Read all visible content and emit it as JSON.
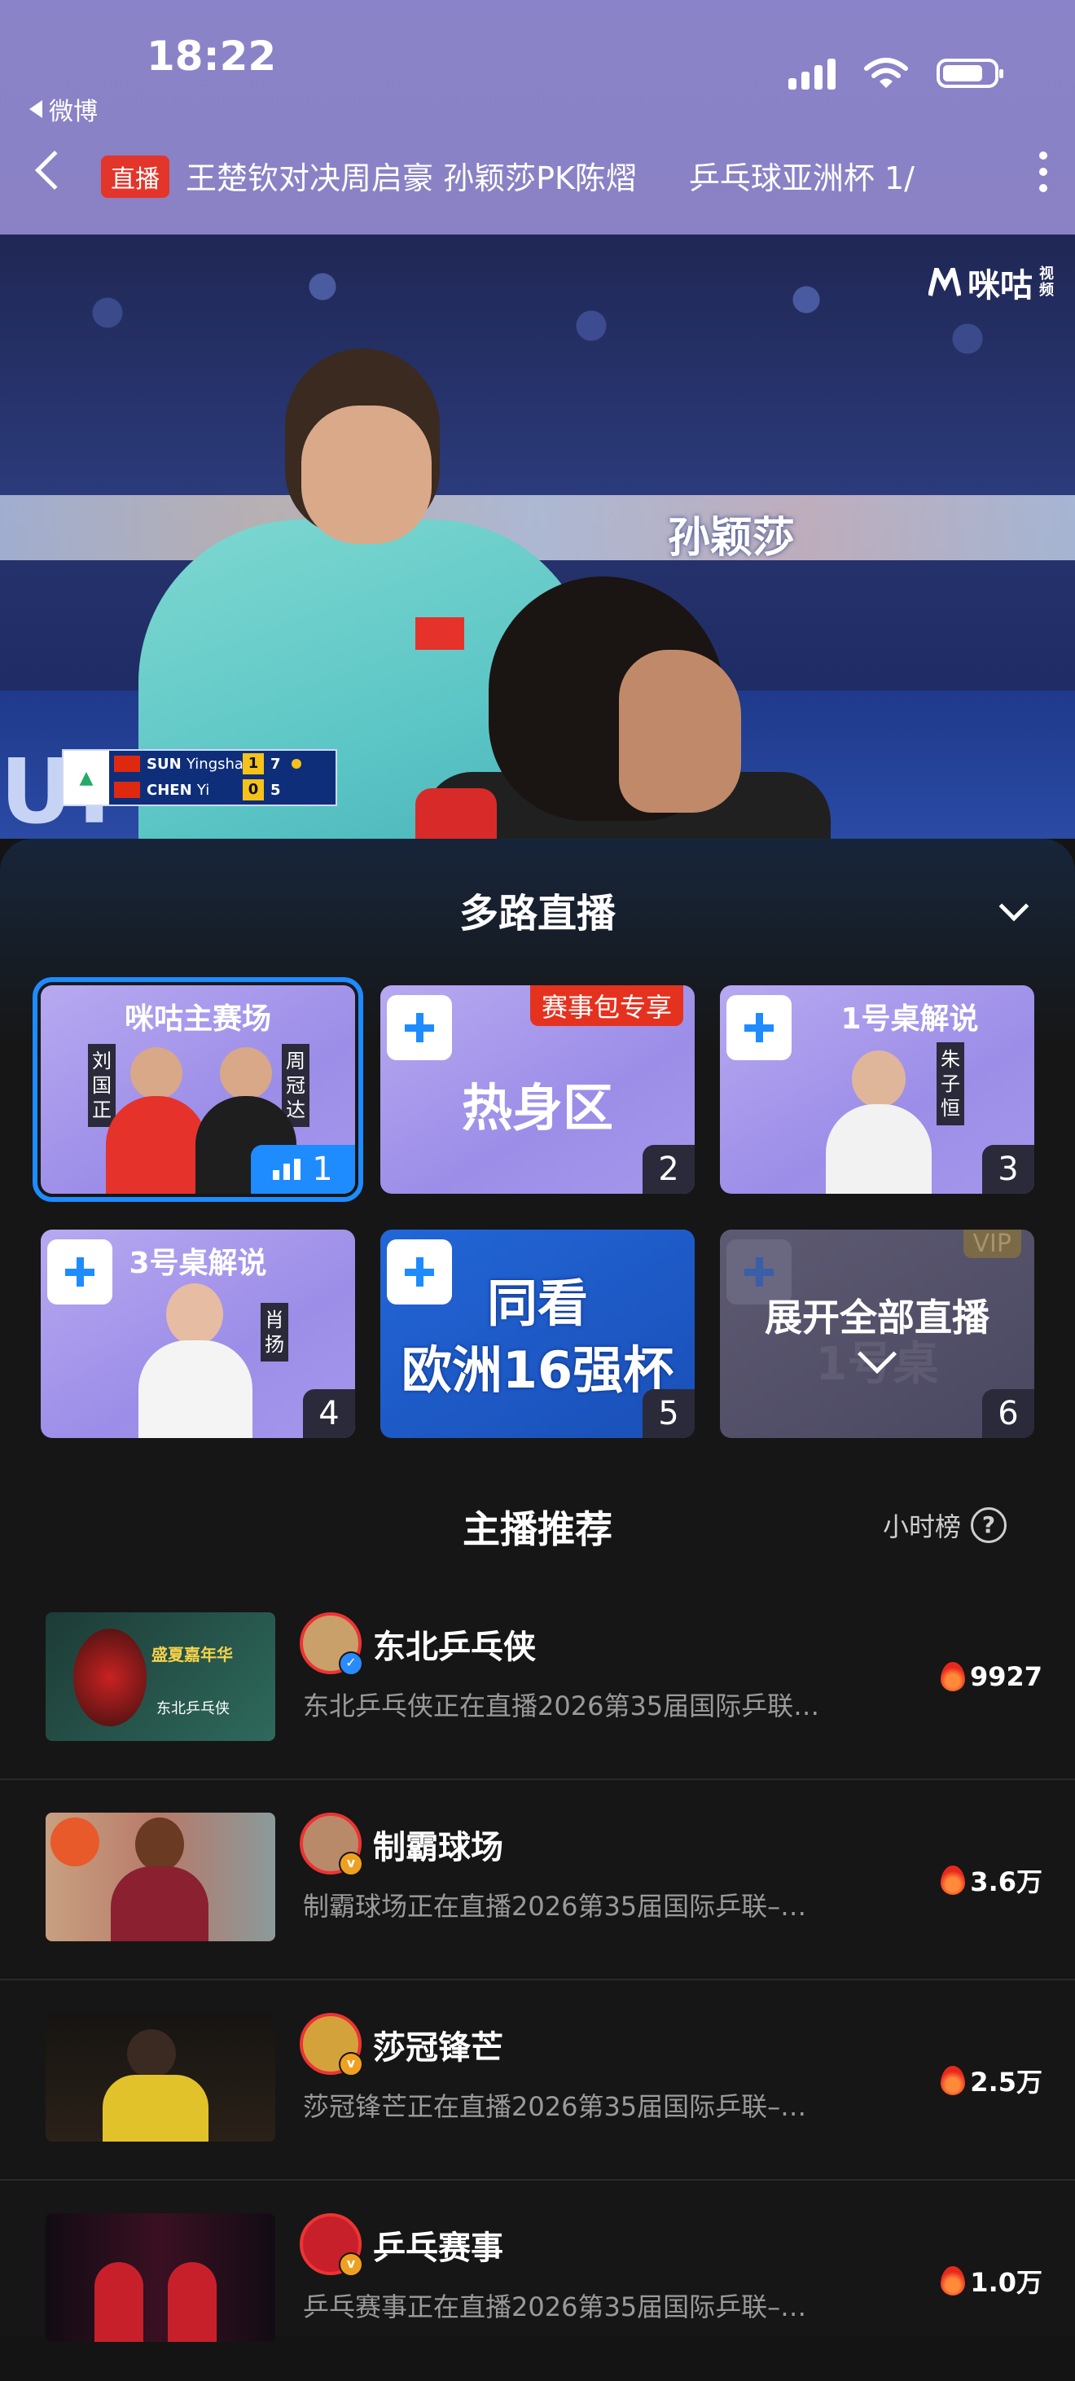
{
  "status": {
    "time": "18:22",
    "back_app": "微博"
  },
  "header": {
    "live_badge": "直播",
    "title": "王楚钦对决周启豪 孙颖莎PK陈熠",
    "title_next": "乒乓球亚洲杯 1/"
  },
  "video": {
    "watermark": "咪咕",
    "watermark_small": "视频",
    "banner_name": "孙颖莎",
    "board_text": "UP        BY WINDO",
    "scoreboard": {
      "rows": [
        {
          "surname": "SUN",
          "given": "Yingsha",
          "games": "1",
          "points": "7",
          "serving": true
        },
        {
          "surname": "CHEN",
          "given": "Yi",
          "games": "0",
          "points": "5",
          "serving": false
        }
      ]
    }
  },
  "multi_live": {
    "title": "多路直播",
    "cards": [
      {
        "label": "咪咕主赛场",
        "number": "1",
        "left_name": "刘国正",
        "right_name": "周冠达",
        "active": true
      },
      {
        "big": "热身区",
        "number": "2",
        "tag": "赛事包专享"
      },
      {
        "label": "1号桌解说",
        "number": "3",
        "right_name": "朱子恒"
      },
      {
        "label": "3号桌解说",
        "number": "4",
        "right_name": "肖扬"
      },
      {
        "big_line1": "同看",
        "big_line2": "欧洲16强杯",
        "number": "5"
      },
      {
        "expand": "展开全部直播",
        "ghost": "1号桌",
        "number": "6",
        "tag": "VIP"
      }
    ]
  },
  "recommend": {
    "title": "主播推荐",
    "rank_label": "小时榜",
    "rank_icon": "help-icon",
    "items": [
      {
        "name": "东北乒乓侠",
        "desc": "东北乒乓侠正在直播2026第35届国际乒联…",
        "heat": "9927",
        "badge": "verified",
        "thumb_text": "盛夏嘉年华",
        "thumb_sub": "东北乒乓侠"
      },
      {
        "name": "制霸球场",
        "desc": "制霸球场正在直播2026第35届国际乒联–…",
        "heat": "3.6万",
        "badge": "v"
      },
      {
        "name": "莎冠锋芒",
        "desc": "莎冠锋芒正在直播2026第35届国际乒联–…",
        "heat": "2.5万",
        "badge": "v"
      },
      {
        "name": "乒乓赛事",
        "desc": "乒乓赛事正在直播2026第35届国际乒联–…",
        "heat": "1.0万",
        "badge": "v"
      }
    ]
  },
  "colors": {
    "accent": "#1e8bff",
    "live_red": "#e3352a",
    "header_bg": "#8b83c9"
  }
}
